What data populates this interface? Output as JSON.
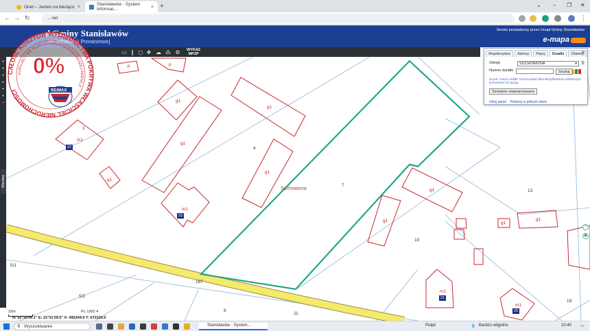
{
  "browser": {
    "tabs": [
      {
        "label": "Onet – Jesteś na bieżąco",
        "active": false
      },
      {
        "label": "Stanisławów - System Informac...",
        "active": true
      }
    ],
    "url": "...net"
  },
  "header": {
    "title": "...d Gminy Stanisławów",
    "subtitle": "...em Informacji Przestrzennej",
    "serwis": "Serwis prowadzony przez Urząd Gminy Stanisławów",
    "emapa": "e-mapa"
  },
  "toolbar": {
    "wykaz": "WYKAZ",
    "mpzp": "MPZP"
  },
  "sidebar": {
    "warstwy": "Warstwy"
  },
  "panel": {
    "tabs": [
      "Współrzędne",
      "Adresy",
      "Plany",
      "Działki",
      "Obiekty"
    ],
    "active_tab": "Działki",
    "obreb_label": "Obręb",
    "obreb_value": "SUCHOWIZNA",
    "numer_label": "Numer działki",
    "szukaj": "Szukaj",
    "hint": "W pole \"Numer działki\" można wpisać kilka identyfikatorów oddzielonych przecinkiem lub spacją.",
    "advanced": "Szukanie zaawansowane",
    "ukryj": "Ukryj panel",
    "pokazuj": "Pokazuj w jednym oknie"
  },
  "map": {
    "town": "Suchowizna",
    "labels": {
      "p1": "p",
      "p2": "p",
      "g1a": "g1",
      "g1b": "g1",
      "g1c": "g1",
      "g1d": "g1",
      "g1e": "g1",
      "g1f": "g1",
      "g1g": "g1",
      "g1h": "g1",
      "g1i": "g1",
      "m1a": "m1",
      "m1b": "m1",
      "m1c": "m1",
      "m1d": "m1",
      "n1": "1",
      "n4": "4",
      "n7": "7",
      "n13": "13",
      "n10": "10",
      "n51": "5/1",
      "n52": "5/2",
      "n187": "187",
      "n8": "8",
      "n11": "11",
      "n19": "19"
    },
    "badges": {
      "b22": "22",
      "b23": "23",
      "b21": "21",
      "b20": "20"
    },
    "scale": "10m",
    "crs": "PL-1992",
    "coords": "N: 52°16'09.1\"  E: 21°31'29.5\"  X: 492244.0  Y: 672220.5"
  },
  "watermark": {
    "percent": "0%",
    "ring_text": "CAŁOŚĆ KOSZTÓW POŚREDNICTWA POKRYWA WŁAŚCICIEL NIERUCHOMOŚCI",
    "inner_text": "KUPUJĄCY NIE PŁACI WYNAGRODZENIA NASZEJ AGENCJI",
    "brand": "RE/MAX"
  },
  "taskbar": {
    "search": "Wyszukiwanie",
    "app": "Stanisławów - System...",
    "pulpit": "Pulpit",
    "weather": "Bardzo wilgotno",
    "time": "10:40"
  }
}
